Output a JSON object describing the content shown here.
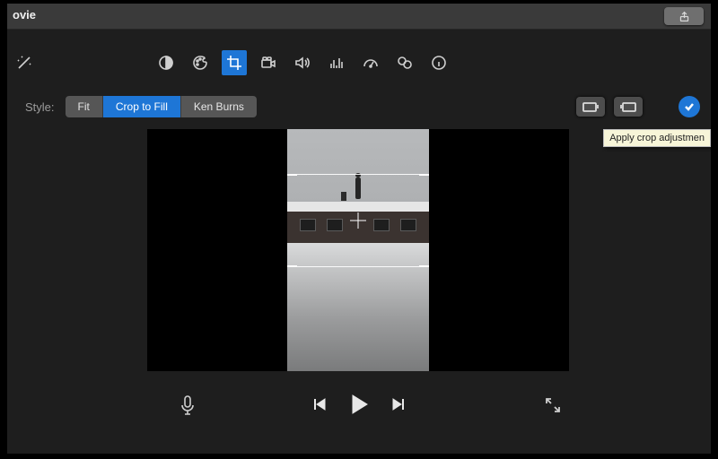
{
  "titlebar": {
    "title": "ovie"
  },
  "toolbar": {
    "items": [
      {
        "name": "wand-icon"
      },
      {
        "name": "contrast-icon"
      },
      {
        "name": "palette-icon"
      },
      {
        "name": "crop-icon",
        "selected": true
      },
      {
        "name": "camera-icon"
      },
      {
        "name": "volume-icon"
      },
      {
        "name": "equalizer-icon"
      },
      {
        "name": "speed-icon"
      },
      {
        "name": "clips-icon"
      },
      {
        "name": "info-icon"
      }
    ]
  },
  "style": {
    "label": "Style:",
    "options": [
      "Fit",
      "Crop to Fill",
      "Ken Burns"
    ],
    "active": 1,
    "tooltip": "Apply crop adjustmen"
  },
  "transport": {
    "mic": "mic-icon",
    "prev": "prev-icon",
    "play": "play-icon",
    "next": "next-icon",
    "expand": "expand-icon"
  }
}
